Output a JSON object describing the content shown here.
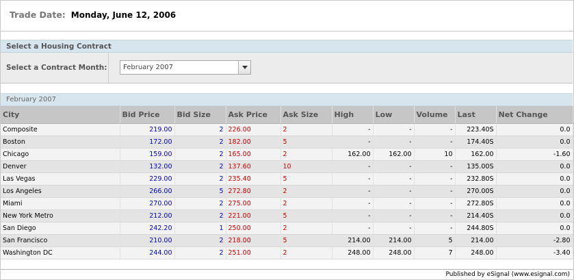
{
  "trade_date": {
    "label": "Trade Date:",
    "value": "Monday, June 12, 2006"
  },
  "select_section": {
    "title": "Select a Housing Contract",
    "month_label": "Select a Contract Month:",
    "selected_month": "February 2007"
  },
  "table_section": {
    "title": "February 2007",
    "columns": [
      "City",
      "Bid Price",
      "Bid Size",
      "Ask Price",
      "Ask Size",
      "High",
      "Low",
      "Volume",
      "Last",
      "Net Change"
    ],
    "rows": [
      [
        "Composite",
        "219.00",
        "2",
        "226.00",
        "2",
        "-",
        "-",
        "-",
        "223.40S",
        "0.0"
      ],
      [
        "Boston",
        "172.00",
        "2",
        "182.00",
        "5",
        "-",
        "-",
        "-",
        "174.40S",
        "0.0"
      ],
      [
        "Chicago",
        "159.00",
        "2",
        "165.00",
        "2",
        "162.00",
        "162.00",
        "10",
        "162.00",
        "-1.60"
      ],
      [
        "Denver",
        "132.00",
        "2",
        "137.60",
        "10",
        "-",
        "-",
        "-",
        "135.00S",
        "0.0"
      ],
      [
        "Las Vegas",
        "229.00",
        "2",
        "235.40",
        "5",
        "-",
        "-",
        "-",
        "232.80S",
        "0.0"
      ],
      [
        "Los Angeles",
        "266.00",
        "5",
        "272.80",
        "2",
        "-",
        "-",
        "-",
        "270.00S",
        "0.0"
      ],
      [
        "Miami",
        "270.00",
        "2",
        "275.00",
        "2",
        "-",
        "-",
        "-",
        "272.80S",
        "0.0"
      ],
      [
        "New York Metro",
        "212.00",
        "2",
        "221.00",
        "5",
        "-",
        "-",
        "-",
        "214.40S",
        "0.0"
      ],
      [
        "San Diego",
        "242.20",
        "1",
        "250.00",
        "2",
        "-",
        "-",
        "-",
        "244.80S",
        "0.0"
      ],
      [
        "San Francisco",
        "210.00",
        "2",
        "218.00",
        "5",
        "214.00",
        "214.00",
        "5",
        "214.00",
        "-2.80"
      ],
      [
        "Washington DC",
        "244.00",
        "2",
        "251.00",
        "2",
        "248.00",
        "248.00",
        "7",
        "248.00",
        "-3.40"
      ]
    ]
  },
  "footer": {
    "text": "Published by eSignal (www.esignal.com)"
  },
  "colors": {
    "bid": "#0000cc",
    "ask": "#cc0000",
    "section_header": "#d7e5ee",
    "column_header": "#c6c6c6"
  }
}
